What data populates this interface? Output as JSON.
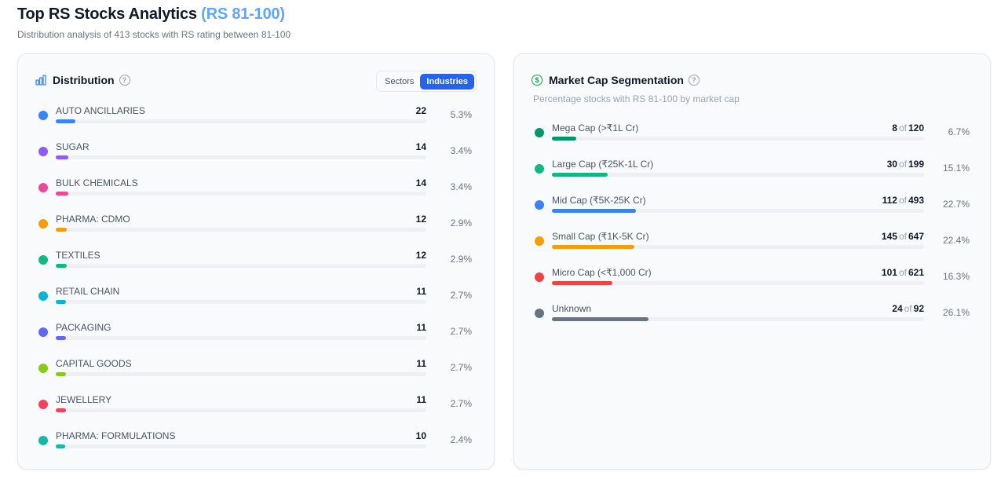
{
  "header": {
    "title": "Top RS Stocks Analytics",
    "title_accent": "(RS 81-100)",
    "subtitle": "Distribution analysis of 413 stocks with RS rating between 81-100"
  },
  "distribution": {
    "title": "Distribution",
    "toggle": {
      "sectors": "Sectors",
      "industries": "Industries",
      "active": "industries"
    },
    "items": [
      {
        "label": "AUTO ANCILLARIES",
        "count": "22",
        "pct": "5.3%",
        "color": "#3b82f6",
        "fraction": 0.053
      },
      {
        "label": "SUGAR",
        "count": "14",
        "pct": "3.4%",
        "color": "#8b5cf6",
        "fraction": 0.034
      },
      {
        "label": "BULK CHEMICALS",
        "count": "14",
        "pct": "3.4%",
        "color": "#ec4899",
        "fraction": 0.034
      },
      {
        "label": "PHARMA: CDMO",
        "count": "12",
        "pct": "2.9%",
        "color": "#f59e0b",
        "fraction": 0.029
      },
      {
        "label": "TEXTILES",
        "count": "12",
        "pct": "2.9%",
        "color": "#10b981",
        "fraction": 0.029
      },
      {
        "label": "RETAIL CHAIN",
        "count": "11",
        "pct": "2.7%",
        "color": "#06b6d4",
        "fraction": 0.027
      },
      {
        "label": "PACKAGING",
        "count": "11",
        "pct": "2.7%",
        "color": "#6366f1",
        "fraction": 0.027
      },
      {
        "label": "CAPITAL GOODS",
        "count": "11",
        "pct": "2.7%",
        "color": "#84cc16",
        "fraction": 0.027
      },
      {
        "label": "JEWELLERY",
        "count": "11",
        "pct": "2.7%",
        "color": "#f43f5e",
        "fraction": 0.027
      },
      {
        "label": "PHARMA: FORMULATIONS",
        "count": "10",
        "pct": "2.4%",
        "color": "#14b8a6",
        "fraction": 0.024
      }
    ]
  },
  "market_cap": {
    "title": "Market Cap Segmentation",
    "subtitle": "Percentage stocks with RS 81-100 by market cap",
    "of_word": "of",
    "items": [
      {
        "label": "Mega Cap (>₹1L Cr)",
        "count": "8",
        "total": "120",
        "pct": "6.7%",
        "color": "#059669",
        "fraction": 0.067
      },
      {
        "label": "Large Cap (₹25K-1L Cr)",
        "count": "30",
        "total": "199",
        "pct": "15.1%",
        "color": "#10b981",
        "fraction": 0.151
      },
      {
        "label": "Mid Cap (₹5K-25K Cr)",
        "count": "112",
        "total": "493",
        "pct": "22.7%",
        "color": "#3b82f6",
        "fraction": 0.227
      },
      {
        "label": "Small Cap (₹1K-5K Cr)",
        "count": "145",
        "total": "647",
        "pct": "22.4%",
        "color": "#f59e0b",
        "fraction": 0.224
      },
      {
        "label": "Micro Cap (<₹1,000 Cr)",
        "count": "101",
        "total": "621",
        "pct": "16.3%",
        "color": "#ef4444",
        "fraction": 0.163
      },
      {
        "label": "Unknown",
        "count": "24",
        "total": "92",
        "pct": "26.1%",
        "color": "#6b7280",
        "fraction": 0.261
      }
    ]
  }
}
